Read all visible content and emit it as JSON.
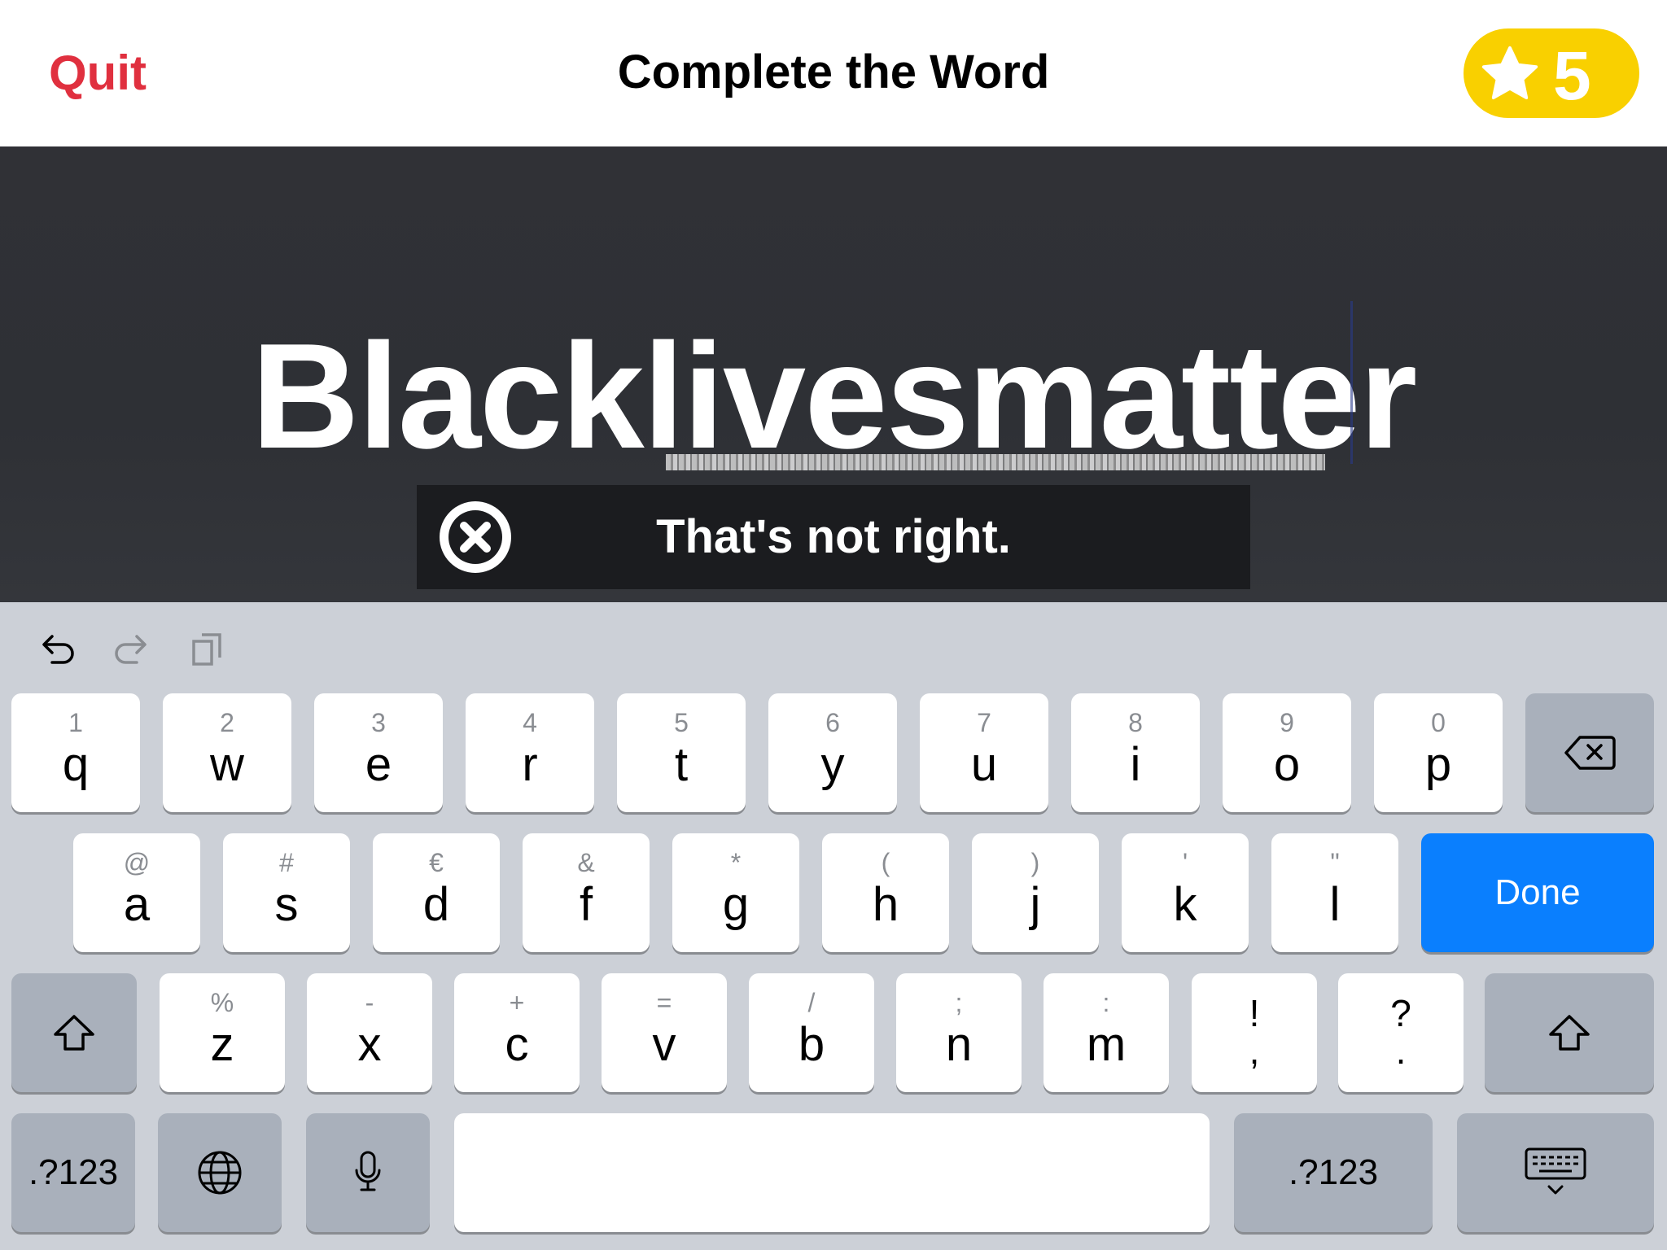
{
  "header": {
    "quit_label": "Quit",
    "title": "Complete the Word",
    "stars": "5",
    "accent_color": "#e0303f",
    "badge_color": "#f9d000"
  },
  "game": {
    "word": "Blacklivesmatter",
    "feedback_text": "That's not right."
  },
  "keyboard": {
    "toolbar": [
      "undo-icon",
      "redo-icon",
      "clipboard-icon"
    ],
    "row1": [
      {
        "sub": "1",
        "main": "q"
      },
      {
        "sub": "2",
        "main": "w"
      },
      {
        "sub": "3",
        "main": "e"
      },
      {
        "sub": "4",
        "main": "r"
      },
      {
        "sub": "5",
        "main": "t"
      },
      {
        "sub": "6",
        "main": "y"
      },
      {
        "sub": "7",
        "main": "u"
      },
      {
        "sub": "8",
        "main": "i"
      },
      {
        "sub": "9",
        "main": "o"
      },
      {
        "sub": "0",
        "main": "p"
      }
    ],
    "row2": [
      {
        "sub": "@",
        "main": "a"
      },
      {
        "sub": "#",
        "main": "s"
      },
      {
        "sub": "€",
        "main": "d"
      },
      {
        "sub": "&",
        "main": "f"
      },
      {
        "sub": "*",
        "main": "g"
      },
      {
        "sub": "(",
        "main": "h"
      },
      {
        "sub": ")",
        "main": "j"
      },
      {
        "sub": "'",
        "main": "k"
      },
      {
        "sub": "\"",
        "main": "l"
      }
    ],
    "row3": [
      {
        "sub": "%",
        "main": "z"
      },
      {
        "sub": "-",
        "main": "x"
      },
      {
        "sub": "+",
        "main": "c"
      },
      {
        "sub": "=",
        "main": "v"
      },
      {
        "sub": "/",
        "main": "b"
      },
      {
        "sub": ";",
        "main": "n"
      },
      {
        "sub": ":",
        "main": "m"
      }
    ],
    "punct": [
      {
        "top": "!",
        "bottom": ","
      },
      {
        "top": "?",
        "bottom": "."
      }
    ],
    "done_label": "Done",
    "numbers_label": ".?123",
    "done_color": "#0a7ffe"
  }
}
